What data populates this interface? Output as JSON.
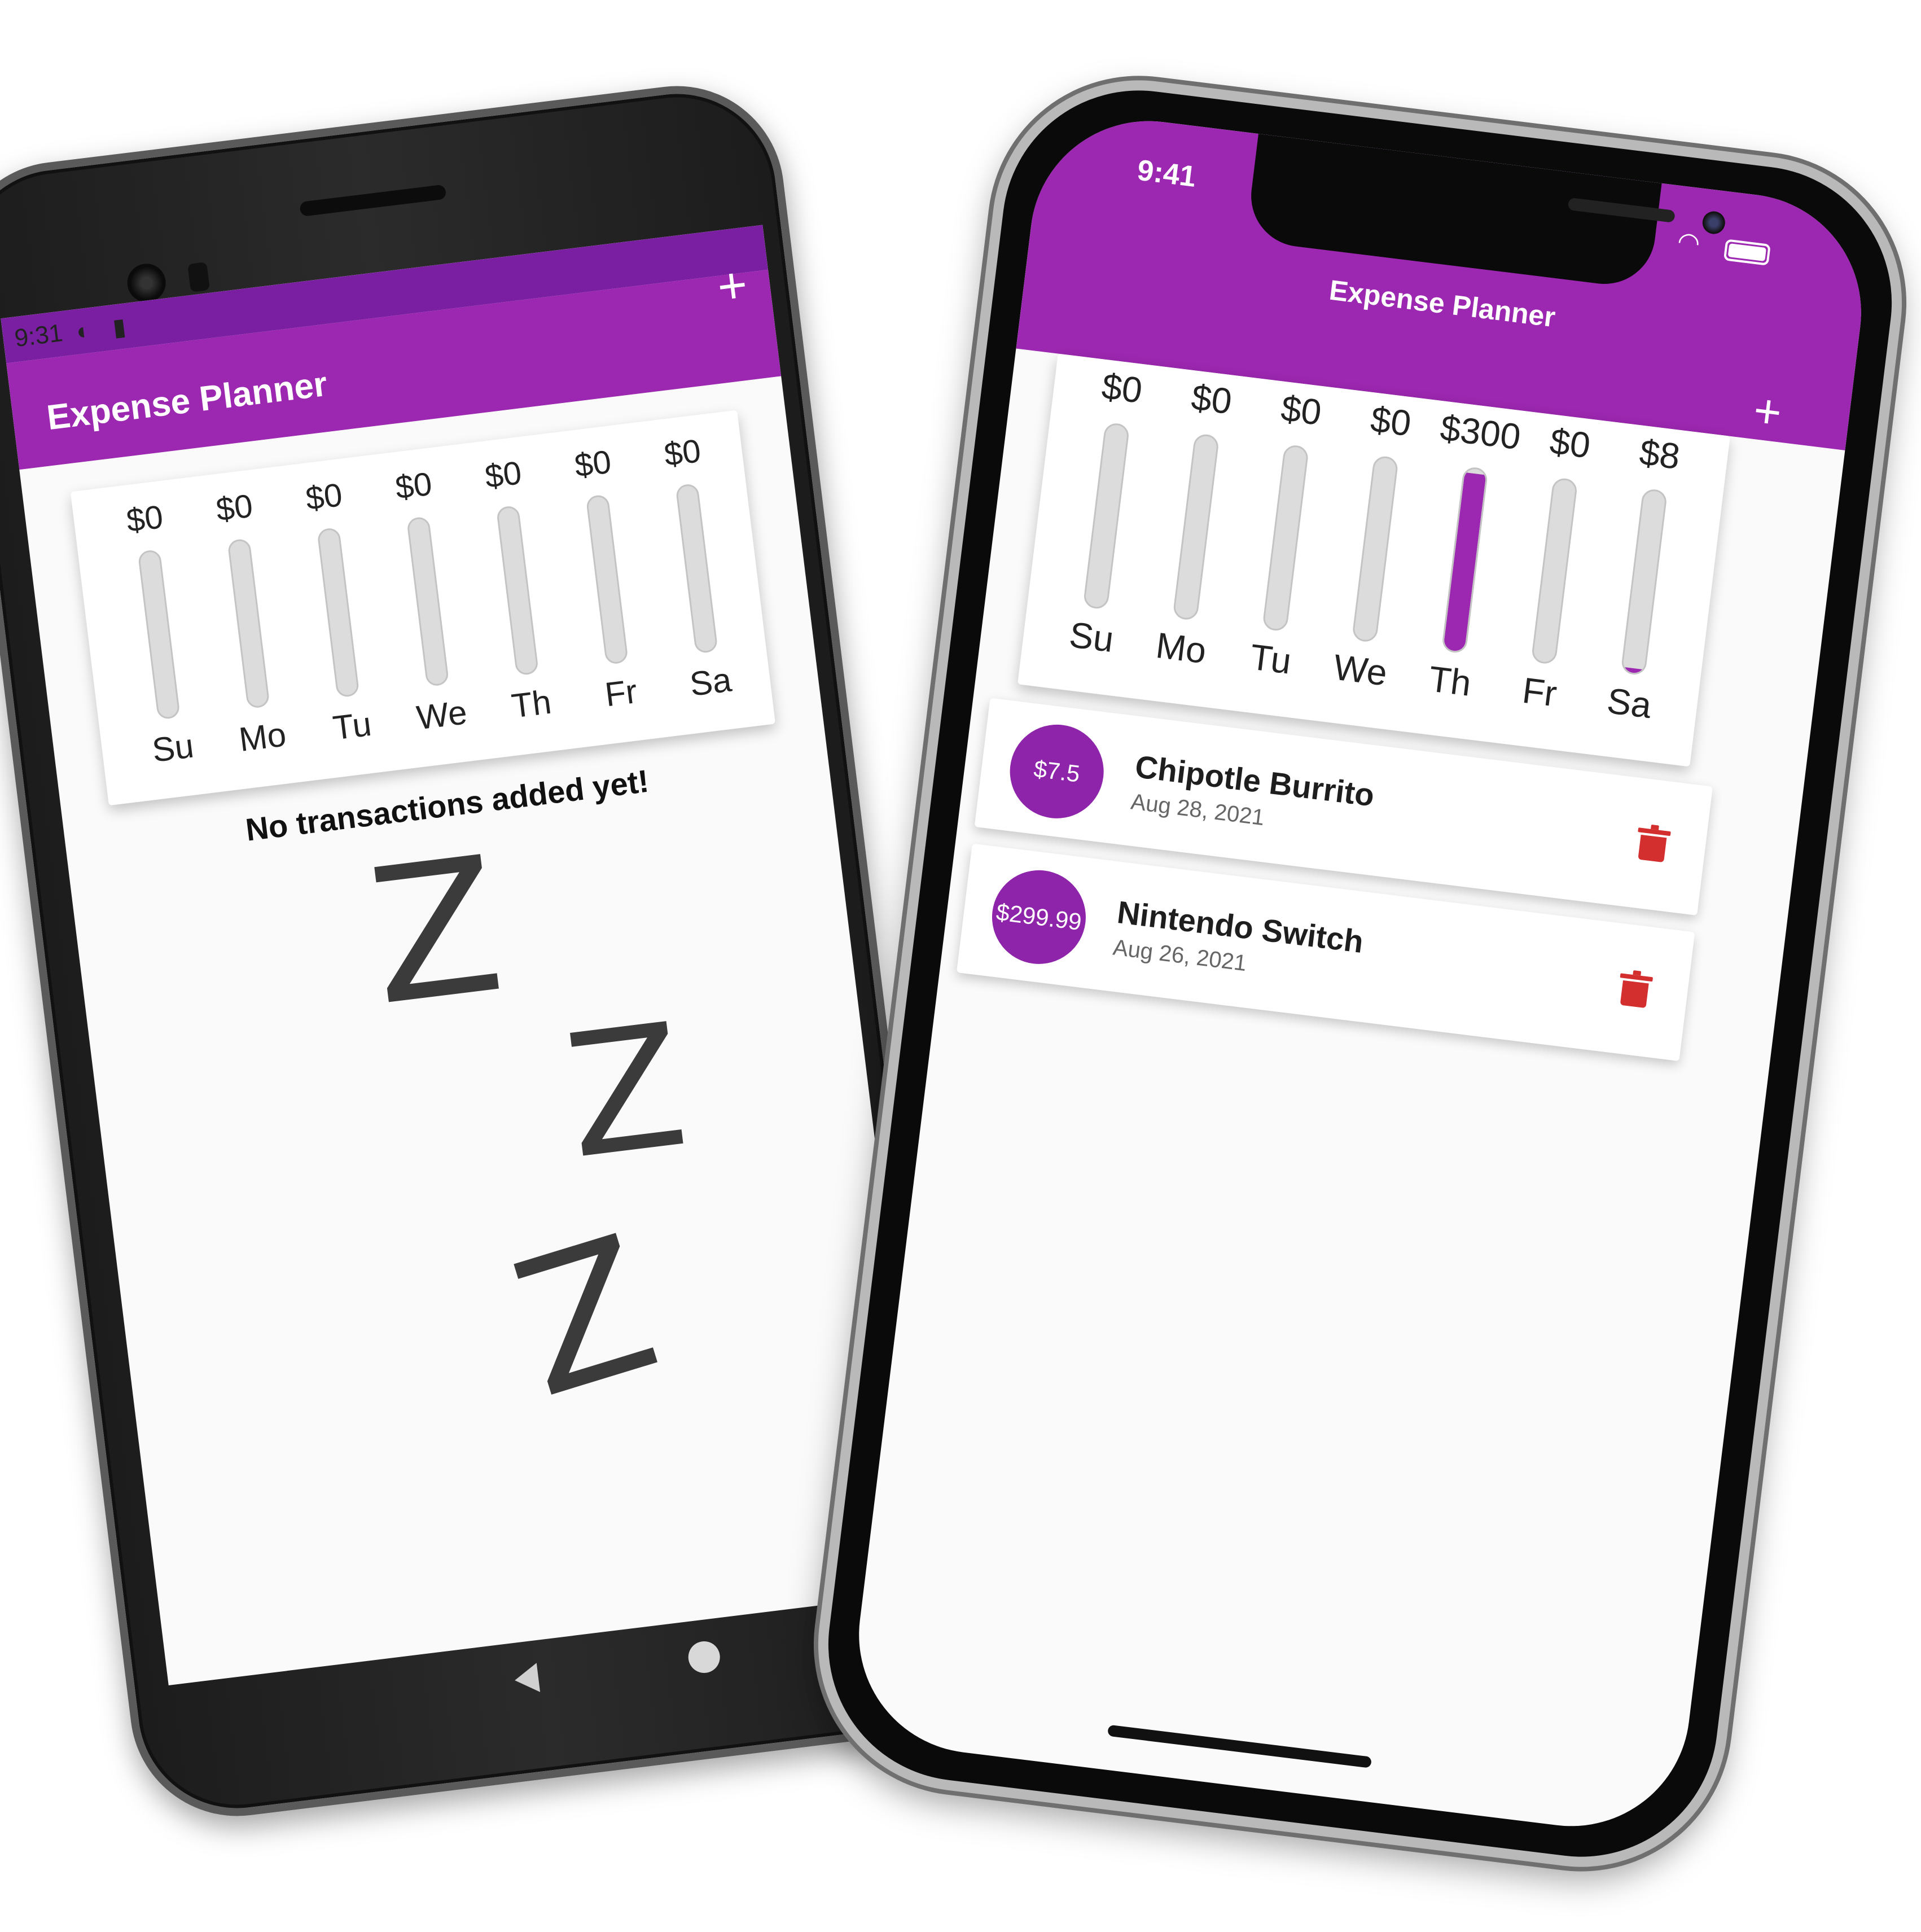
{
  "android": {
    "statusbar": {
      "time": "9:31"
    },
    "appbar": {
      "title": "Expense Planner",
      "add_label": "+"
    },
    "chart": [
      {
        "day": "Su",
        "amount": "$0",
        "fraction": 0
      },
      {
        "day": "Mo",
        "amount": "$0",
        "fraction": 0
      },
      {
        "day": "Tu",
        "amount": "$0",
        "fraction": 0
      },
      {
        "day": "We",
        "amount": "$0",
        "fraction": 0
      },
      {
        "day": "Th",
        "amount": "$0",
        "fraction": 0
      },
      {
        "day": "Fr",
        "amount": "$0",
        "fraction": 0
      },
      {
        "day": "Sa",
        "amount": "$0",
        "fraction": 0
      }
    ],
    "empty": {
      "message": "No transactions added yet!",
      "glyphs": [
        "Z",
        "Z",
        "Z"
      ]
    }
  },
  "iphone": {
    "statusbar": {
      "time": "9:41"
    },
    "appbar": {
      "title": "Expense Planner",
      "add_label": "+"
    },
    "chart": [
      {
        "day": "Su",
        "amount": "$0",
        "fraction": 0
      },
      {
        "day": "Mo",
        "amount": "$0",
        "fraction": 0
      },
      {
        "day": "Tu",
        "amount": "$0",
        "fraction": 0
      },
      {
        "day": "We",
        "amount": "$0",
        "fraction": 0
      },
      {
        "day": "Th",
        "amount": "$300",
        "fraction": 0.976
      },
      {
        "day": "Fr",
        "amount": "$0",
        "fraction": 0
      },
      {
        "day": "Sa",
        "amount": "$8",
        "fraction": 0.024
      }
    ],
    "transactions": [
      {
        "amount": "$7.5",
        "title": "Chipotle Burrito",
        "date": "Aug 28, 2021"
      },
      {
        "amount": "$299.99",
        "title": "Nintendo Switch",
        "date": "Aug 26, 2021"
      }
    ]
  },
  "colors": {
    "primary": "#9c27b0",
    "primary_dark": "#7b1fa2",
    "delete": "#d32f2f"
  },
  "icons": [
    "plus-icon",
    "trash-icon",
    "wifi-icon",
    "battery-icon"
  ]
}
